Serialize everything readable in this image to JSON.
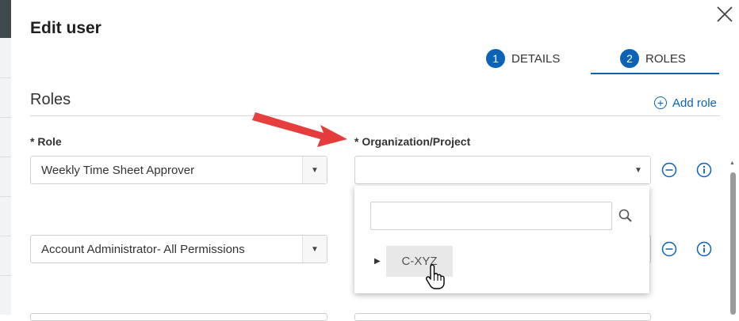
{
  "dialog": {
    "title": "Edit user",
    "close_icon": "close-icon"
  },
  "steps": [
    {
      "number": "1",
      "label": "DETAILS",
      "active": false
    },
    {
      "number": "2",
      "label": "ROLES",
      "active": true
    }
  ],
  "roles_section": {
    "title": "Roles",
    "add_role_label": "Add role",
    "role_column_label": "* Role",
    "org_column_label": "* Organization/Project",
    "rows": [
      {
        "role": "Weekly Time Sheet Approver",
        "organization": ""
      },
      {
        "role": "Account Administrator- All Permissions",
        "organization": ""
      }
    ]
  },
  "org_dropdown": {
    "search_value": "",
    "search_icon": "search-icon",
    "tree_items": [
      {
        "label": "C-XYZ",
        "expanded": false,
        "hovered": true
      }
    ]
  },
  "colors": {
    "accent": "#0b62b7",
    "annotation_arrow": "#e8403f"
  }
}
